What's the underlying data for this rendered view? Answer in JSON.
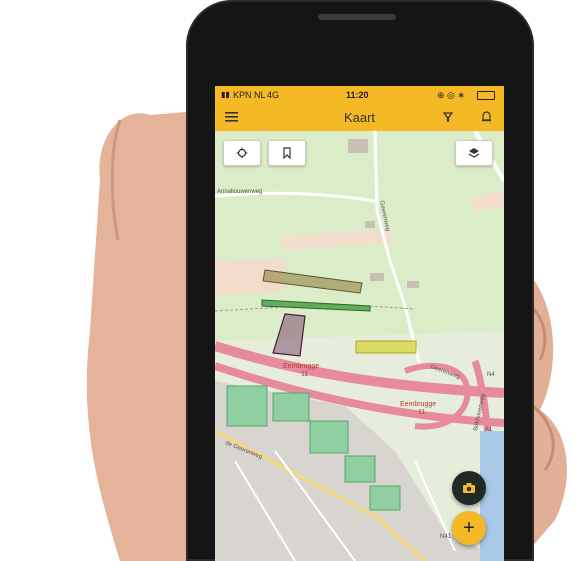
{
  "status_bar": {
    "carrier": "KPN NL",
    "network": "4G",
    "time": "11:20"
  },
  "app_bar": {
    "title": "Kaart",
    "menu_icon": "hamburger-menu-icon",
    "filter_icon": "filter-icon",
    "notification_icon": "bell-icon"
  },
  "map": {
    "controls": {
      "locate_icon": "crosshair-icon",
      "bookmark_icon": "bookmark-icon",
      "layers_icon": "layers-icon"
    },
    "labels": {
      "road1": "Annaliouwenweg",
      "road2": "Geerenweg",
      "place1": "Eembrugge",
      "place1_num": "11",
      "place2": "Eembrugge",
      "place2_num": "11",
      "road3": "de Geerenweg",
      "road4": "Geerenweg",
      "road5": "Birkhovenweg",
      "hw1": "N4",
      "hw2": "A1",
      "hw3": "N41"
    },
    "colors": {
      "parcel_brown": "#8a7a3a",
      "parcel_green": "#3b9a3b",
      "parcel_purple": "#6b2d5c",
      "parcel_yellow": "#d6d43a",
      "highway": "#e68a9c",
      "grass": "#cfe8b8"
    }
  },
  "fabs": {
    "camera_icon": "camera-icon",
    "add_icon": "plus-icon",
    "add_label": "+"
  },
  "accent_color": "#f5b926"
}
